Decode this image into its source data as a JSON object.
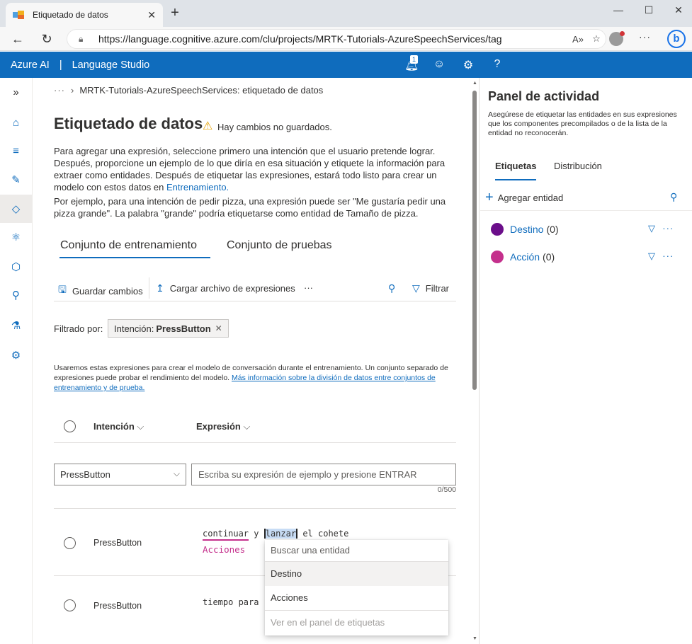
{
  "browser": {
    "tab_title": "Etiquetado de datos",
    "url": "https://language.cognitive.azure.com/clu/projects/MRTK-Tutorials-AzureSpeechServices/tag"
  },
  "header": {
    "brand": "Azure AI",
    "separator": "|",
    "product": "Language Studio",
    "notifications_count": "1",
    "help": "?"
  },
  "breadcrumb": {
    "ellipsis": "···",
    "current": "MRTK-Tutorials-AzureSpeechServices: etiquetado de datos"
  },
  "page": {
    "title": "Etiquetado de datos",
    "unsaved": "Hay cambios no guardados.",
    "intro_1": "Para agregar una expresión, seleccione primero una intención que el usuario pretende lograr. Después, proporcione un ejemplo de lo que diría en esa situación y etiquete la información para extraer como entidades. Después de etiquetar las expresiones, estará todo listo para crear un modelo con estos datos en ",
    "intro_link": "Entrenamiento.",
    "intro_2": "Por ejemplo, para una intención de pedir pizza, una expresión puede ser \"Me gustaría pedir una pizza grande\". La palabra \"grande\" podría etiquetarse como entidad de Tamaño de pizza."
  },
  "tabs": {
    "training": "Conjunto de entrenamiento",
    "testing": "Conjunto de pruebas"
  },
  "commands": {
    "save": "Guardar cambios",
    "upload": "Cargar archivo de expresiones",
    "more": "···",
    "filter": "Filtrar"
  },
  "filter": {
    "label": "Filtrado por:",
    "chip_key": "Intención: ",
    "chip_value": "PressButton"
  },
  "note": {
    "text": "Usaremos estas expresiones para crear el modelo de conversación durante el entrenamiento. Un conjunto separado de expresiones puede probar el rendimiento del modelo. ",
    "link": "Más información sobre la división de datos entre conjuntos de entrenamiento y de prueba."
  },
  "table": {
    "col_intent": "Intención",
    "col_utterance": "Expresión",
    "new_intent_value": "PressButton",
    "utterance_placeholder": "Escriba su expresión de ejemplo y presione ENTRAR",
    "counter": "0/500",
    "rows": [
      {
        "intent": "PressButton",
        "tokens": [
          "continuar",
          "y",
          "lanzar",
          "el cohete"
        ],
        "entity_label": "Acciones"
      },
      {
        "intent": "PressButton",
        "text": "tiempo para r"
      }
    ]
  },
  "entity_popup": {
    "search_placeholder": "Buscar una entidad",
    "options": [
      "Destino",
      "Acciones"
    ],
    "footer": "Ver en el panel de etiquetas"
  },
  "activity_panel": {
    "title": "Panel de actividad",
    "description": "Asegúrese de etiquetar las entidades en sus expresiones que los componentes precompilados o de la lista de la entidad no reconocerán.",
    "tab_labels": "Etiquetas",
    "tab_distribution": "Distribución",
    "add_entity": "Agregar entidad",
    "entities": [
      {
        "name": "Destino",
        "count": "(0)",
        "color": "#6b0e8a"
      },
      {
        "name": "Acción",
        "count": "(0)",
        "color": "#c4308c"
      }
    ]
  },
  "colors": {
    "accent": "#0f6cbd",
    "entity_underline": "#c4308c"
  }
}
